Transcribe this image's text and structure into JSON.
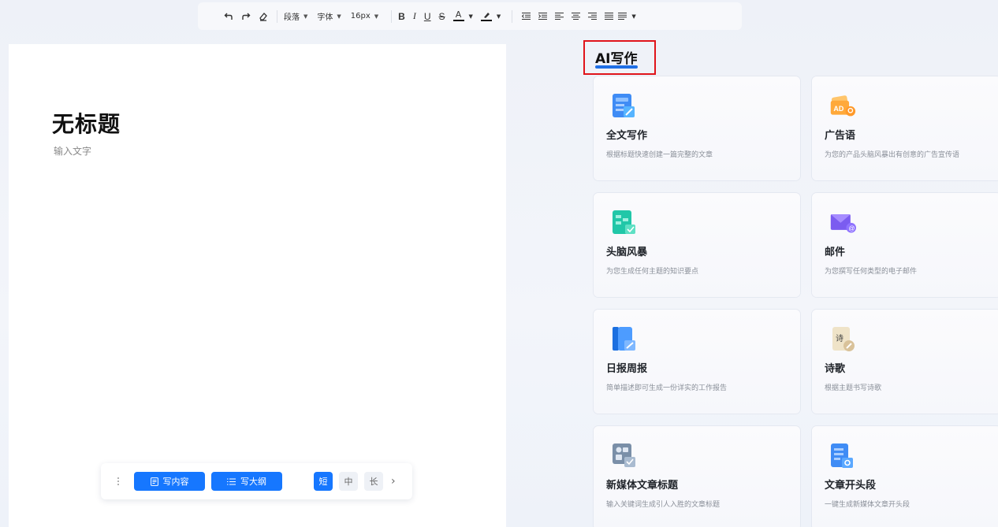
{
  "toolbar": {
    "paragraph_label": "段落",
    "font_label": "字体",
    "size_label": "16px",
    "bold": "B",
    "italic": "I",
    "underline": "U",
    "strike": "S",
    "font_color_glyph": "A"
  },
  "editor": {
    "title": "无标题",
    "placeholder": "输入文字",
    "bottom_bar": {
      "write_content": "写内容",
      "write_outline": "写大纲",
      "length_short": "短",
      "length_medium": "中",
      "length_long": "长"
    }
  },
  "ai_panel": {
    "title": "AI写作",
    "cards": [
      {
        "name": "全文写作",
        "desc": "根据标题快速创建一篇完整的文章",
        "icon": "doc-write-icon"
      },
      {
        "name": "广告语",
        "desc": "为您的产品头脑风暴出有创意的广告宣传语",
        "icon": "ad-icon"
      },
      {
        "name": "头脑风暴",
        "desc": "为您生成任何主题的知识要点",
        "icon": "mindmap-icon"
      },
      {
        "name": "邮件",
        "desc": "为您撰写任何类型的电子邮件",
        "icon": "mail-icon"
      },
      {
        "name": "日报周报",
        "desc": "简单描述即可生成一份详实的工作报告",
        "icon": "report-icon"
      },
      {
        "name": "诗歌",
        "desc": "根据主题书写诗歌",
        "icon": "poem-icon"
      },
      {
        "name": "新媒体文章标题",
        "desc": "输入关键词生成引人入胜的文章标题",
        "icon": "media-title-icon"
      },
      {
        "name": "文章开头段",
        "desc": "一键生成新媒体文章开头段",
        "icon": "article-intro-icon"
      }
    ]
  },
  "colors": {
    "accent": "#1677ff",
    "highlight_box": "#e0141a"
  }
}
